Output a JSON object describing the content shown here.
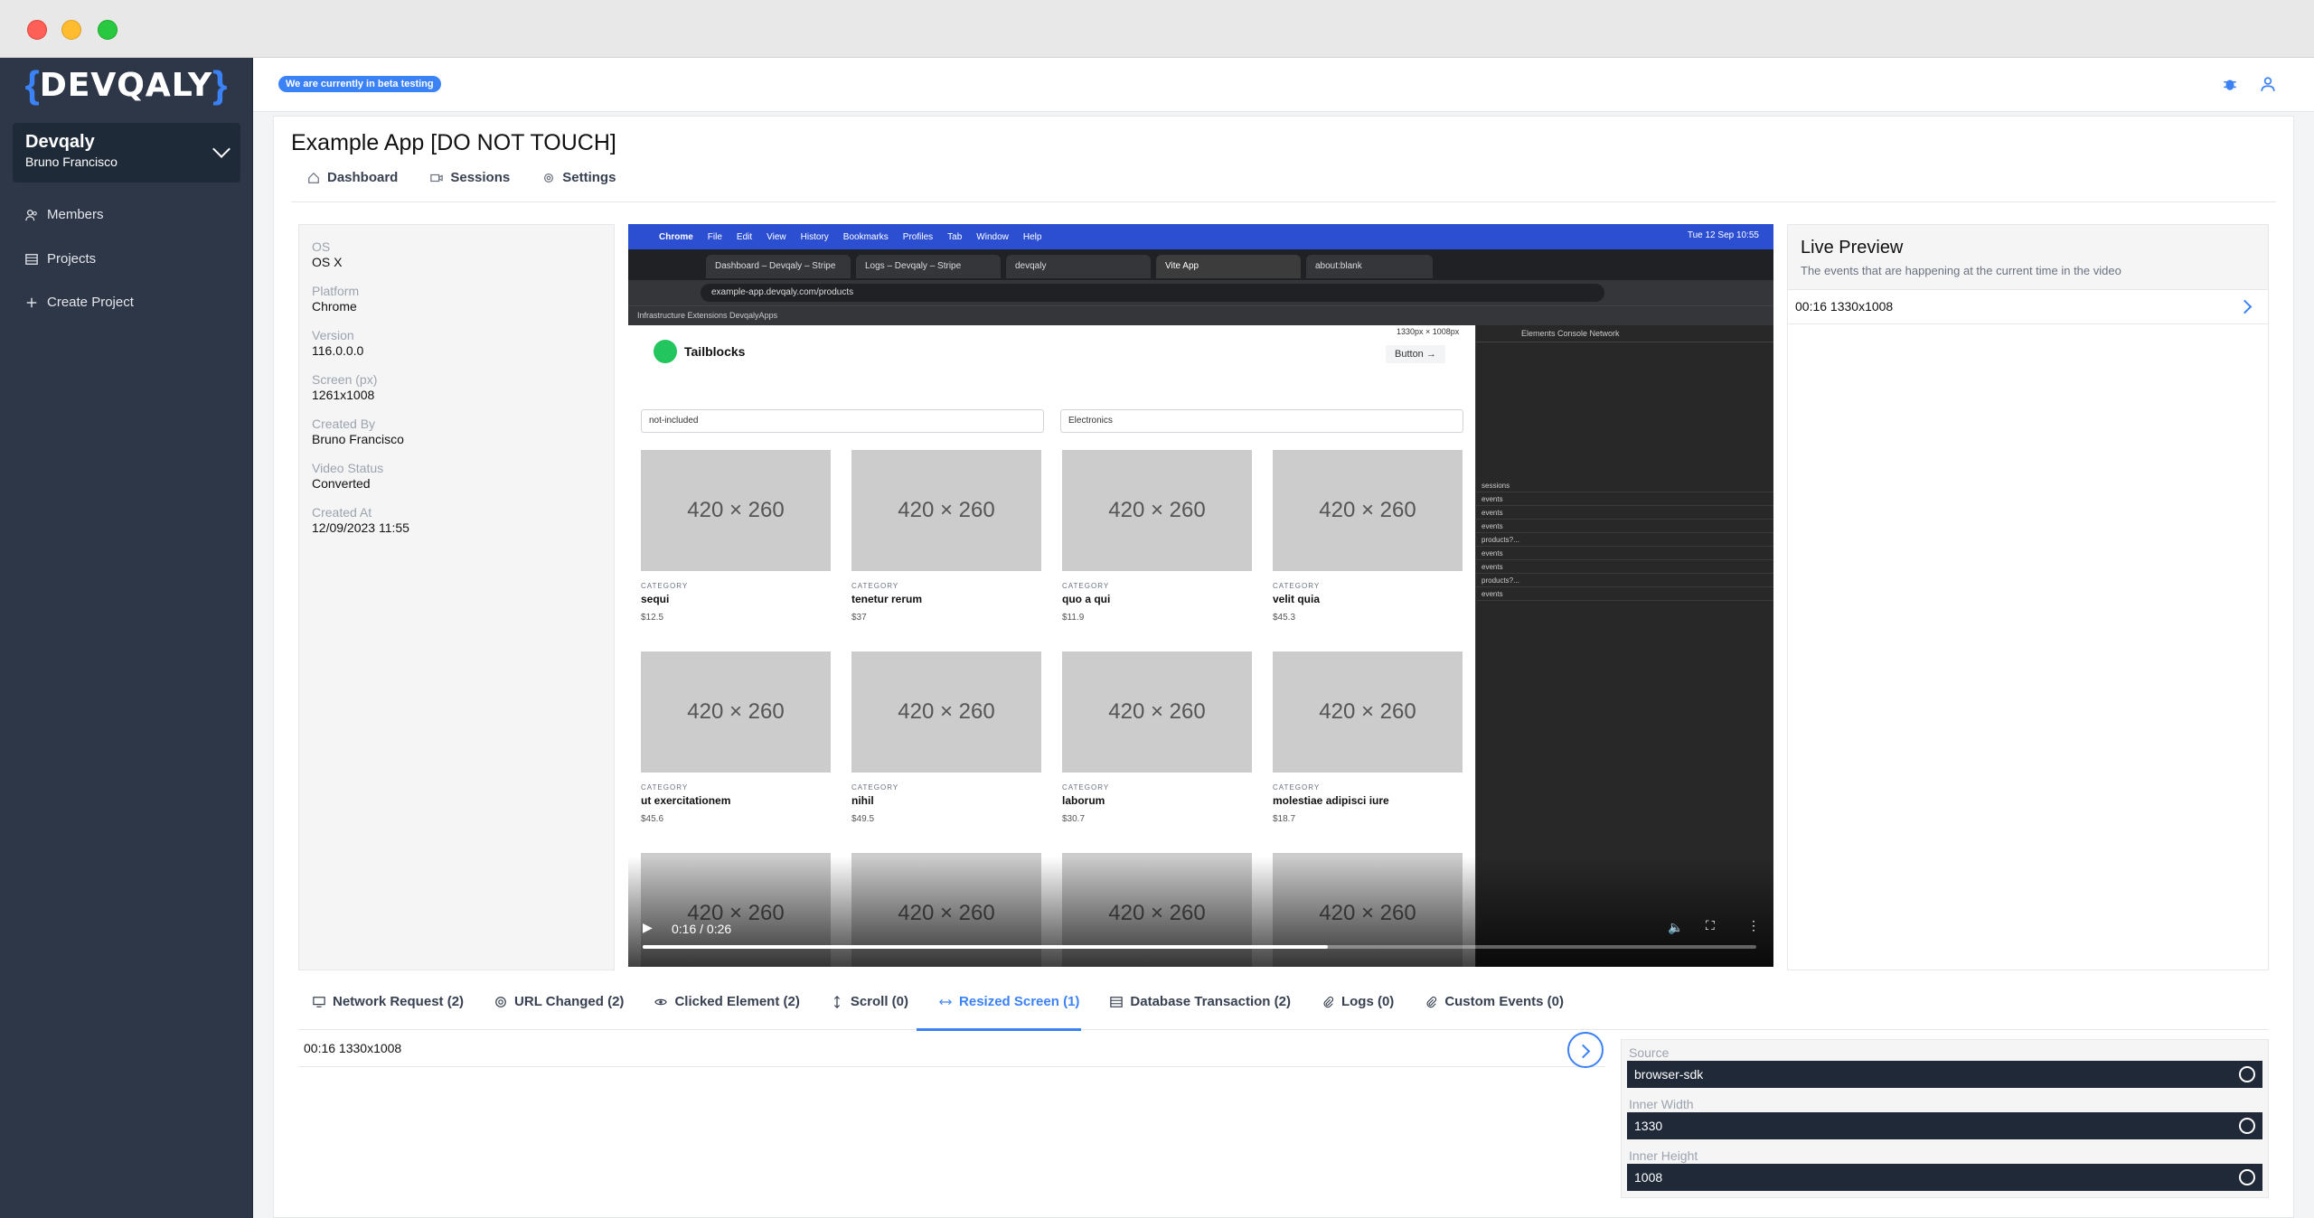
{
  "window": {
    "controls": [
      "close",
      "minimize",
      "maximize"
    ]
  },
  "sidebar": {
    "logo": "DEVQALY",
    "org": {
      "name": "Devqaly",
      "user": "Bruno Francisco"
    },
    "items": [
      {
        "label": "Members",
        "icon": "users-icon"
      },
      {
        "label": "Projects",
        "icon": "table-icon"
      },
      {
        "label": "Create Project",
        "icon": "plus-icon"
      }
    ]
  },
  "topbar": {
    "beta_badge": "We are currently in beta testing",
    "icons": [
      "bug-icon",
      "user-icon"
    ]
  },
  "page": {
    "title": "Example App [DO NOT TOUCH]",
    "tabs": [
      "Dashboard",
      "Sessions",
      "Settings"
    ]
  },
  "session_info": {
    "fields": [
      {
        "label": "OS",
        "value": "OS X"
      },
      {
        "label": "Platform",
        "value": "Chrome"
      },
      {
        "label": "Version",
        "value": "116.0.0.0"
      },
      {
        "label": "Screen (px)",
        "value": "1261x1008"
      },
      {
        "label": "Created By",
        "value": "Bruno Francisco"
      },
      {
        "label": "Video Status",
        "value": "Converted"
      },
      {
        "label": "Created At",
        "value": "12/09/2023 11:55"
      }
    ]
  },
  "video": {
    "menubar": [
      "Chrome",
      "File",
      "Edit",
      "View",
      "History",
      "Bookmarks",
      "Profiles",
      "Tab",
      "Window",
      "Help"
    ],
    "clock": "Tue 12 Sep  10:55",
    "tabs": [
      "Dashboard – Devqaly – Stripe",
      "Logs – Devqaly – Stripe",
      "devqaly",
      "Vite App",
      "about:blank"
    ],
    "url": "example-app.devqaly.com/products",
    "bookmarks": "Infrastructure   Extensions   DevqalyApps",
    "page_brand": "Tailblocks",
    "page_button": "Button →",
    "size_tag": "1330px × 1008px",
    "filter_left": "not-included",
    "filter_right": "Electronics",
    "products": [
      {
        "img": "420 × 260",
        "cat": "CATEGORY",
        "name": "sequi",
        "price": "$12.5"
      },
      {
        "img": "420 × 260",
        "cat": "CATEGORY",
        "name": "tenetur rerum",
        "price": "$37"
      },
      {
        "img": "420 × 260",
        "cat": "CATEGORY",
        "name": "quo a qui",
        "price": "$11.9"
      },
      {
        "img": "420 × 260",
        "cat": "CATEGORY",
        "name": "velit quia",
        "price": "$45.3"
      },
      {
        "img": "420 × 260",
        "cat": "CATEGORY",
        "name": "ut exercitationem",
        "price": "$45.6"
      },
      {
        "img": "420 × 260",
        "cat": "CATEGORY",
        "name": "nihil",
        "price": "$49.5"
      },
      {
        "img": "420 × 260",
        "cat": "CATEGORY",
        "name": "laborum",
        "price": "$30.7"
      },
      {
        "img": "420 × 260",
        "cat": "CATEGORY",
        "name": "molestiae adipisci iure",
        "price": "$18.7"
      },
      {
        "img": "420 × 260"
      },
      {
        "img": "420 × 260"
      },
      {
        "img": "420 × 260"
      },
      {
        "img": "420 × 260"
      }
    ],
    "devtools_tabs": "Elements   Console   Network",
    "devtools_rows": [
      "sessions",
      "events",
      "events",
      "events",
      "products?...",
      "events",
      "events",
      "products?...",
      "events"
    ],
    "time": "0:16 / 0:26",
    "progress": 0.615
  },
  "live_preview": {
    "title": "Live Preview",
    "subtitle": "The events that are happening at the current time in the video",
    "rows": [
      "00:16  1330x1008"
    ]
  },
  "event_tabs": [
    {
      "label": "Network Request (2)",
      "icon": "monitor-icon"
    },
    {
      "label": "URL Changed (2)",
      "icon": "at-icon"
    },
    {
      "label": "Clicked Element (2)",
      "icon": "eye-icon"
    },
    {
      "label": "Scroll (0)",
      "icon": "arrows-vertical-icon"
    },
    {
      "label": "Resized Screen (1)",
      "icon": "arrows-horizontal-icon",
      "active": true
    },
    {
      "label": "Database Transaction (2)",
      "icon": "table-icon"
    },
    {
      "label": "Logs (0)",
      "icon": "paperclip-icon"
    },
    {
      "label": "Custom Events (0)",
      "icon": "paperclip-icon"
    }
  ],
  "events": [
    {
      "text": "00:16  1330x1008"
    }
  ],
  "details": {
    "fields": [
      {
        "label": "Source",
        "value": "browser-sdk"
      },
      {
        "label": "Inner Width",
        "value": "1330"
      },
      {
        "label": "Inner Height",
        "value": "1008"
      }
    ]
  },
  "colors": {
    "accent": "#3b82f6",
    "sidebar": "#2d3748",
    "field_bg": "#1f2937"
  }
}
